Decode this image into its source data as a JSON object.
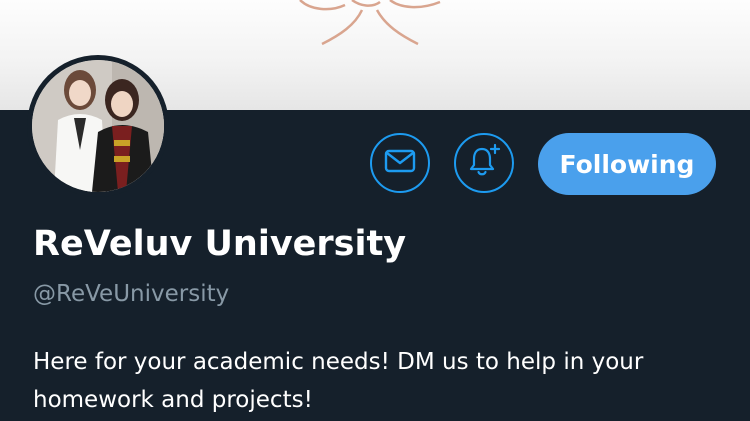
{
  "profile": {
    "display_name": "ReVeluv University",
    "handle": "@ReVeUniversity",
    "bio": "Here for your academic needs! DM us to help in your homework and projects!"
  },
  "actions": {
    "message_icon": "envelope-icon",
    "notify_icon": "bell-plus-icon",
    "follow_label": "Following"
  },
  "colors": {
    "background": "#15202b",
    "accent": "#1d9bf0",
    "follow_button": "#4aa0ec",
    "secondary_text": "#8899a6"
  }
}
